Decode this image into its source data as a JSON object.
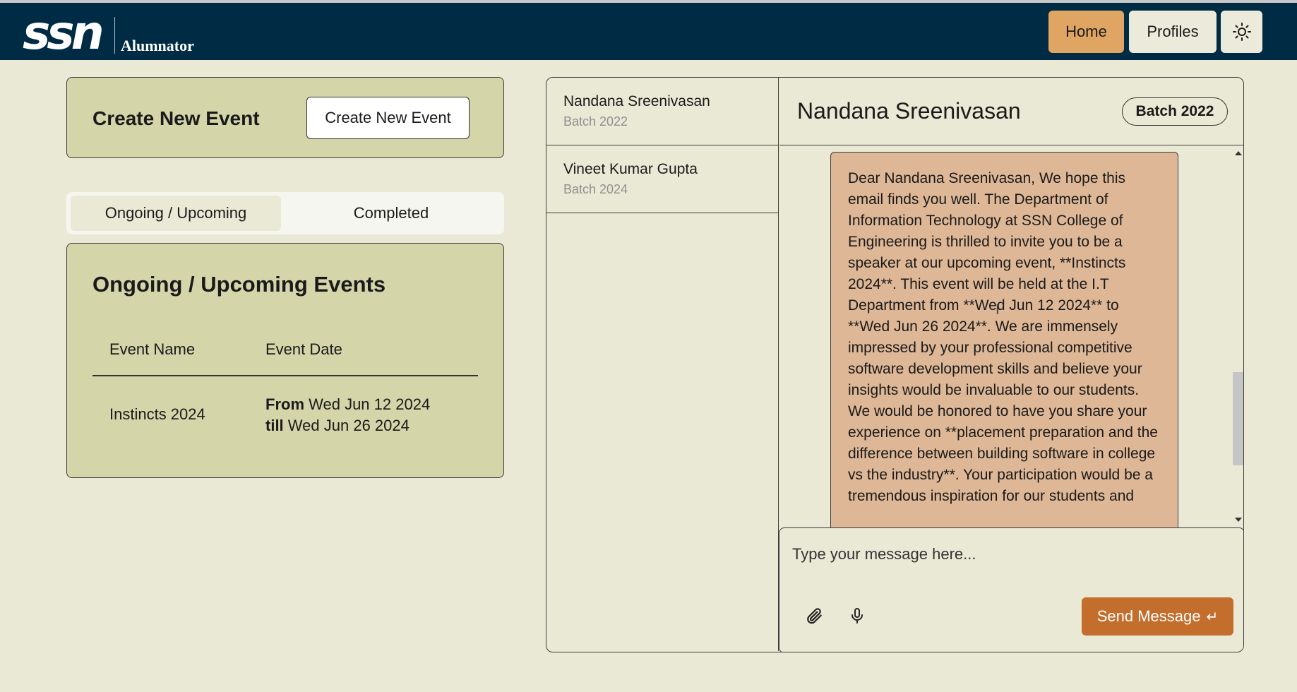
{
  "brand": {
    "mark": "ssn",
    "name": "Alumnator"
  },
  "nav": {
    "home_label": "Home",
    "profiles_label": "Profiles",
    "theme_icon": "sun-icon"
  },
  "create_event": {
    "title": "Create New Event",
    "button_label": "Create New Event"
  },
  "tabs": [
    {
      "label": "Ongoing / Upcoming",
      "active": true
    },
    {
      "label": "Completed",
      "active": false
    }
  ],
  "events_panel": {
    "title": "Ongoing / Upcoming Events",
    "columns": [
      "Event Name",
      "Event Date"
    ],
    "rows": [
      {
        "name": "Instincts 2024",
        "from_label": "From",
        "from": "Wed Jun 12 2024",
        "till_label": "till",
        "till": "Wed Jun 26 2024"
      }
    ]
  },
  "contacts": [
    {
      "name": "Nandana Sreenivasan",
      "batch": "Batch 2022"
    },
    {
      "name": "Vineet Kumar Gupta",
      "batch": "Batch 2024"
    }
  ],
  "chat": {
    "recipient": "Nandana Sreenivasan",
    "batch": "Batch 2022",
    "message": "Dear Nandana Sreenivasan, We hope this email finds you well. The Department of Information Technology at SSN College of Engineering is thrilled to invite you to be a speaker at our upcoming event, **Instincts 2024**. This event will be held at the I.T Department from **Wed Jun 12 2024** to **Wed Jun 26 2024**. We are immensely impressed by your professional competitive software development skills and believe your insights would be invaluable to our students. We would be honored to have you share your experience on **placement preparation and the difference between building software in college vs the industry**. Your participation would be a tremendous inspiration for our students and",
    "input_placeholder": "Type your message here...",
    "send_label": "Send Message",
    "send_icon": "enter-icon",
    "attach_icon": "paperclip-icon",
    "mic_icon": "microphone-icon"
  },
  "colors": {
    "navbar": "#002b45",
    "background": "#eae9d5",
    "card": "#d4d5a9",
    "home_button": "#e0a463",
    "message_bubble": "#deb796",
    "send_button": "#c46e2d"
  }
}
